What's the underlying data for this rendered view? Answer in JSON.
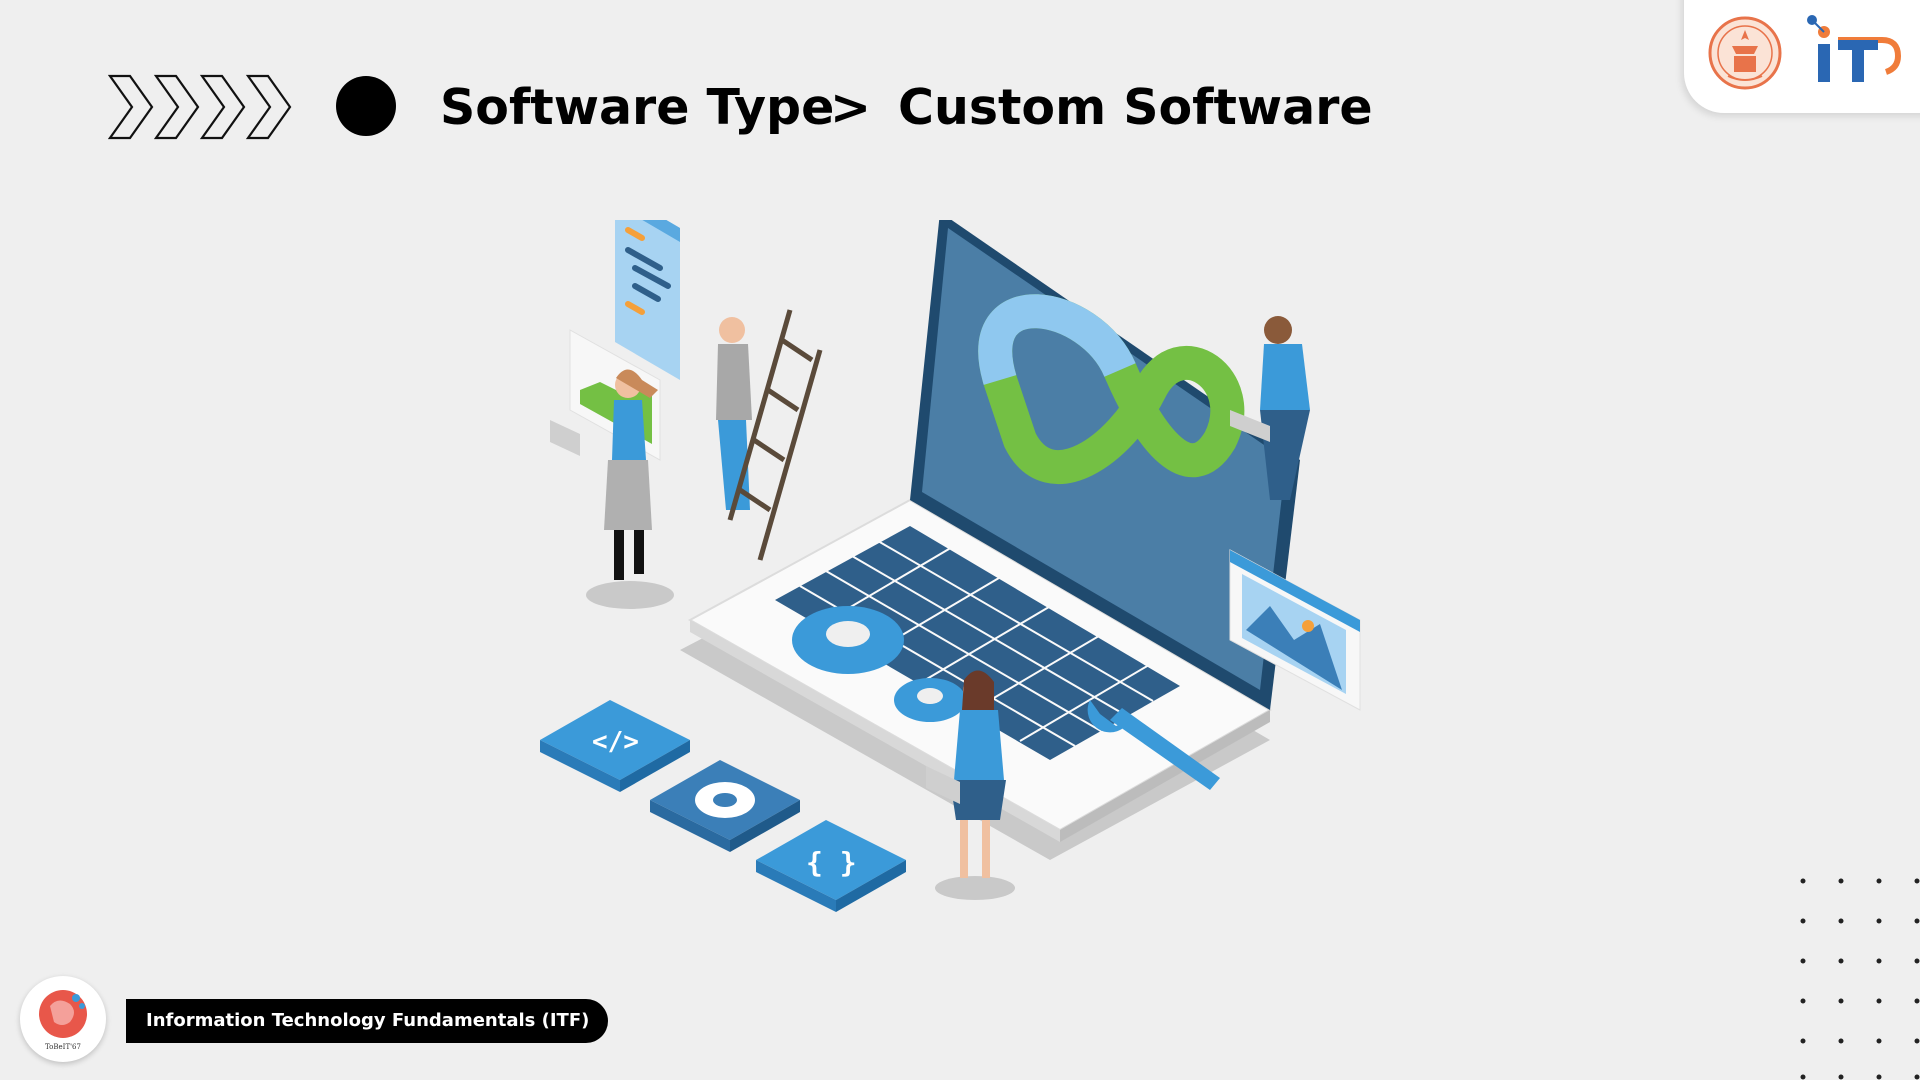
{
  "header": {
    "breadcrumb_parent": "Software Type",
    "breadcrumb_separator": ">",
    "breadcrumb_current": "Custom Software"
  },
  "icons": {
    "chevrons": "chevron-right-icon",
    "bullet": "circle-bullet-icon",
    "university_seal": "seal-icon",
    "it_logo": "it-logo-icon",
    "course_logo": "brain-logo-icon"
  },
  "footer": {
    "course_title": "Information Technology Fundamentals (ITF)",
    "logo_caption": "ToBeIT'67"
  },
  "colors": {
    "background": "#efefef",
    "accent_orange": "#f07c3a",
    "accent_blue": "#2a67b3",
    "illustration_blue": "#3b9ad9",
    "illustration_green": "#74c044"
  }
}
